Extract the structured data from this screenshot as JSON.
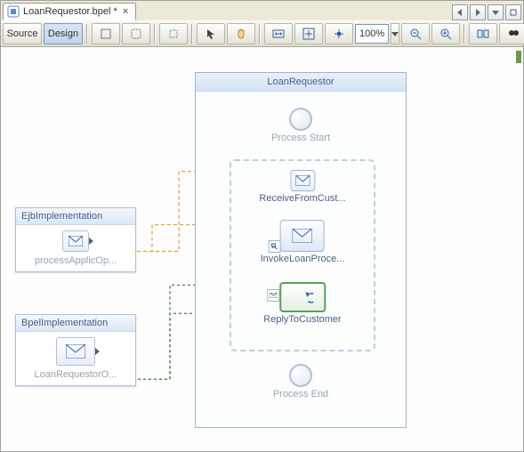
{
  "tab": {
    "title": "LoanRequestor.bpel *"
  },
  "toolbar": {
    "source": "Source",
    "design": "Design",
    "zoom": "100%"
  },
  "partners": {
    "ejb": {
      "title": "EjbImplementation",
      "operation": "processApplicOp..."
    },
    "bpel": {
      "title": "BpelImplementation",
      "operation": "LoanRequestorO..."
    }
  },
  "process": {
    "title": "LoanRequestor",
    "start": "Process Start",
    "end": "Process End",
    "activities": {
      "receive": "ReceiveFromCust...",
      "invoke": "InvokeLoanProce...",
      "reply": "ReplyToCustomer"
    }
  },
  "chart_data": {
    "type": "diagram",
    "process_name": "LoanRequestor",
    "partner_links": [
      {
        "name": "EjbImplementation",
        "operation": "processApplicOp..."
      },
      {
        "name": "BpelImplementation",
        "operation": "LoanRequestorO..."
      }
    ],
    "sequence": [
      {
        "kind": "start",
        "label": "Process Start"
      },
      {
        "kind": "receive",
        "label": "ReceiveFromCust..."
      },
      {
        "kind": "invoke",
        "label": "InvokeLoanProce..."
      },
      {
        "kind": "reply",
        "label": "ReplyToCustomer"
      },
      {
        "kind": "end",
        "label": "Process End"
      }
    ],
    "links": [
      {
        "from": "BpelImplementation",
        "to": "ReceiveFromCust...",
        "style": "dashed-green"
      },
      {
        "from": "BpelImplementation",
        "to": "ReplyToCustomer",
        "style": "dashed-green"
      },
      {
        "from": "EjbImplementation",
        "to": "InvokeLoanProce...",
        "style": "dashed-orange"
      }
    ]
  }
}
